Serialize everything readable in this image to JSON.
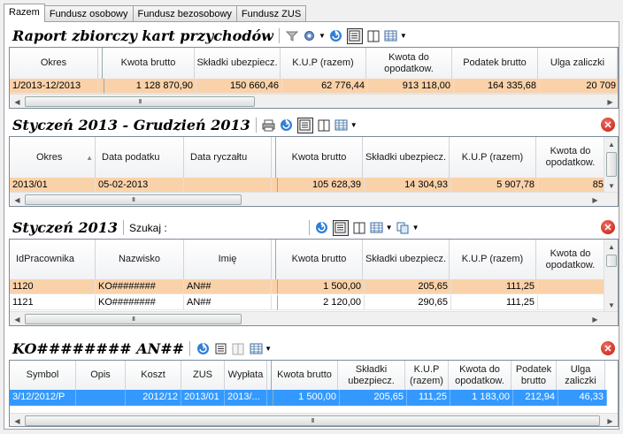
{
  "tabs": [
    "Razem",
    "Fundusz osobowy",
    "Fundusz bezosobowy",
    "Fundusz ZUS"
  ],
  "panel1": {
    "title": "Raport zbiorczy kart przychodów",
    "headers": [
      "Okres",
      "Kwota brutto",
      "Składki ubezpiecz.",
      "K.U.P (razem)",
      "Kwota do opodatkow.",
      "Podatek brutto",
      "Ulga zaliczki"
    ],
    "rows": [
      [
        "1/2013-12/2013",
        "1 128 870,90",
        "150 660,46",
        "62 776,44",
        "913 118,00",
        "164 335,68",
        "20 709"
      ]
    ]
  },
  "panel2": {
    "title": "Styczeń 2013 - Grudzień 2013",
    "headers": [
      "Okres",
      "Data podatku",
      "Data ryczałtu",
      "Kwota brutto",
      "Składki ubezpiecz.",
      "K.U.P (razem)",
      "Kwota do opodatkow."
    ],
    "rows": [
      [
        "2013/01",
        "05-02-2013",
        "",
        "105 628,39",
        "14 304,93",
        "5 907,78",
        "85"
      ]
    ]
  },
  "panel3": {
    "title": "Styczeń 2013",
    "search_label": "Szukaj :",
    "headers": [
      "IdPracownika",
      "Nazwisko",
      "Imię",
      "Kwota brutto",
      "Składki ubezpiecz.",
      "K.U.P (razem)",
      "Kwota do opodatkow."
    ],
    "rows": [
      [
        "1120",
        "KO########",
        "AN##",
        "1 500,00",
        "205,65",
        "111,25",
        ""
      ],
      [
        "1121",
        "KO########",
        "AN##",
        "2 120,00",
        "290,65",
        "111,25",
        ""
      ]
    ]
  },
  "panel4": {
    "title": "KO######## AN##",
    "headers": [
      "Symbol",
      "Opis",
      "Koszt",
      "ZUS",
      "Wypłata",
      "Kwota brutto",
      "Składki ubezpiecz.",
      "K.U.P (razem)",
      "Kwota do opodatkow.",
      "Podatek brutto",
      "Ulga zaliczki"
    ],
    "rows": [
      [
        "3/12/2012/P",
        "",
        "2012/12",
        "2013/01",
        "2013/...",
        "1 500,00",
        "205,65",
        "111,25",
        "1 183,00",
        "212,94",
        "46,33"
      ]
    ]
  },
  "scroll_thumb_label": "III",
  "icons": {
    "filter": "filter-icon",
    "settings": "gear-icon",
    "refresh": "refresh-icon",
    "report": "report-icon",
    "columns": "columns-icon",
    "grid": "grid-icon",
    "print": "print-icon",
    "copy": "copy-icon",
    "close": "close-icon"
  },
  "colors": {
    "highlight": "#fad2aa",
    "selected": "#3399ff",
    "close": "#c01a10"
  }
}
